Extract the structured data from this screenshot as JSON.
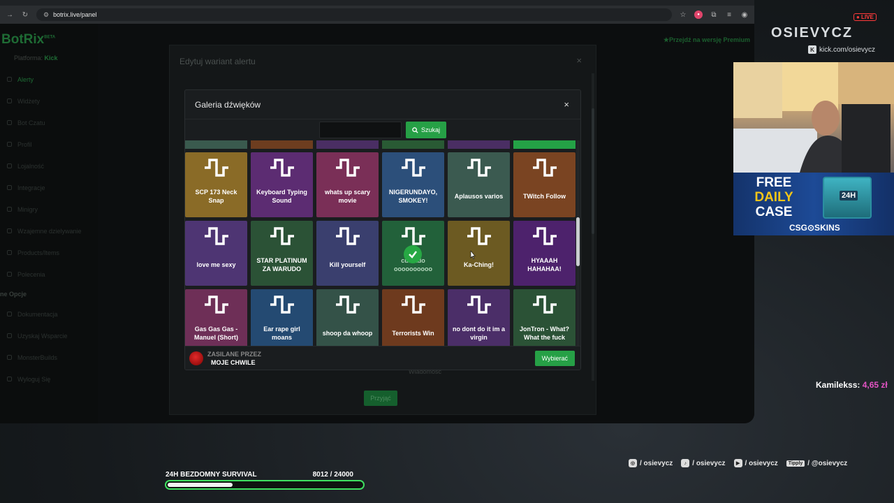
{
  "browser": {
    "url": "botrix.live/panel"
  },
  "sidebar": {
    "logo": "BotRix",
    "logo_badge": "BETA",
    "platform_label": "Platforma:",
    "platform_value": "Kick",
    "items": [
      "Alerty",
      "Widżety",
      "Bot Czatu",
      "Profil",
      "Lojalność",
      "Integracje",
      "Minigry",
      "Wzajemne dzielywanie",
      "Products/Items",
      "Polecenia"
    ],
    "section_head": "ne Opcje",
    "items2": [
      "Dokumentacja",
      "Uzyskaj Wsparcie",
      "MonsterBuilds",
      "Wyloguj Się"
    ],
    "premium": "Przejdź na wersję Premium"
  },
  "outer_modal": {
    "title": "Edytuj wariant alertu",
    "close": "×",
    "accept": "Przyjąć",
    "message": "Wiadomość"
  },
  "gallery": {
    "title": "Galeria dźwięków",
    "close": "×",
    "search_value": "",
    "search_button": "Szukaj",
    "top_strip_colors": [
      "#3a5a4e",
      "#6d3d1f",
      "#4a2e63",
      "#295a34",
      "#4a2e63",
      "#24a246"
    ],
    "tiles": [
      {
        "label": "SCP 173 Neck Snap",
        "color": "#8a6b27"
      },
      {
        "label": "Keyboard Typing Sound",
        "color": "#5c2c72"
      },
      {
        "label": "whats up scary movie",
        "color": "#7a2f57"
      },
      {
        "label": "NIGERUNDAYO, SMOKEY!",
        "color": "#2c4f7a"
      },
      {
        "label": "Aplausos varios",
        "color": "#3b5a50"
      },
      {
        "label": "TWitch Follow",
        "color": "#7a4422"
      },
      {
        "label": "love me sexy",
        "color": "#4e3573"
      },
      {
        "label": "STAR PLATINUM ZA WARUDO",
        "color": "#2b5236"
      },
      {
        "label": "Kill yourself",
        "color": "#3a3f6e"
      },
      {
        "label": "cuidado oooooooooo",
        "color": "#22613a",
        "selected": true
      },
      {
        "label": "Ka-Ching!",
        "color": "#6c5a22"
      },
      {
        "label": "HYAAAH HAHAHAA!",
        "color": "#4d226c"
      },
      {
        "label": "Gas Gas Gas - Manuel (Short)",
        "color": "#6e2f57"
      },
      {
        "label": "Ear rape girl moans",
        "color": "#244a72"
      },
      {
        "label": "shoop da whoop",
        "color": "#345248"
      },
      {
        "label": "Terrorists Win",
        "color": "#6e3a1e"
      },
      {
        "label": "no dont do it im a virgin",
        "color": "#4b2e68"
      },
      {
        "label": "JonTron - What? What the fuck",
        "color": "#2b5236"
      }
    ],
    "powered_by": "ZASILANE PRZEZ",
    "powered_name": "MOJE CHWILE",
    "choose": "Wybierać"
  },
  "overlay": {
    "live": "● LIVE",
    "channel": "OSIEVYCZ",
    "kick": "kick.com/osievycz",
    "promo_line1": "FREE",
    "promo_line2": "DAILY",
    "promo_line3": "CASE",
    "promo_brand": "CSG⊙SKINS",
    "promo_box": "24H",
    "donor": "Kamilekss:",
    "donation": "4,65 zł",
    "goal_title": "24H BEZDOMNY SURVIVAL",
    "goal_progress": "8012  / 24000",
    "goal_fraction": 0.334,
    "socials": [
      {
        "icon": "instagram-icon",
        "text": "/ osievycz"
      },
      {
        "icon": "tiktok-icon",
        "text": "/ osievycz"
      },
      {
        "icon": "youtube-icon",
        "text": "/ osievycz"
      },
      {
        "icon": "tipply-icon",
        "badge": "Tipply",
        "text": "/ @osievycz"
      }
    ]
  }
}
